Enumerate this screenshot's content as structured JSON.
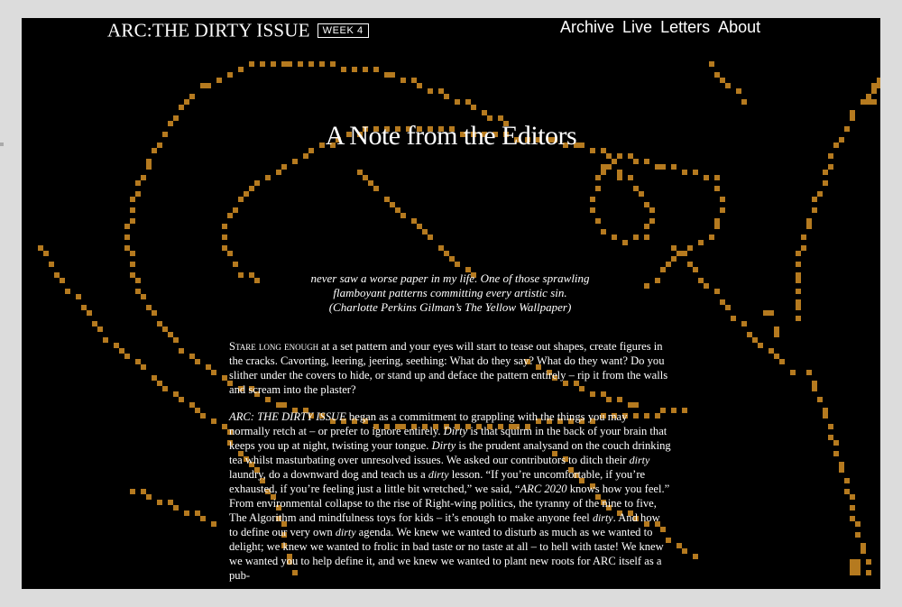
{
  "site": {
    "brand": "ARC:THE DIRTY ISSUE",
    "week": "WEEK 4"
  },
  "nav": [
    "Archive",
    "Live",
    "Letters",
    "About"
  ],
  "article": {
    "title": "A Note from the Editors",
    "epigraph": {
      "line1": "never saw a worse paper in my life. One of those sprawling",
      "line2": "flamboyant patterns committing every artistic sin.",
      "line3": "(Charlotte Perkins Gilman’s The Yellow Wallpaper)"
    },
    "p1": {
      "lead": "Stare long enough",
      "text": " at a set pattern and your eyes will start to tease out shapes, create figures in the cracks. Cavorting, leering, jeering, seething: What do they say? What do they want? Do you slither under the covers to hide, or stand up and deface the pattern entirely – rip it from the walls and scream into the plaster?"
    },
    "p2": {
      "s1": "ARC: THE DIRTY ISSUE",
      "s2": " began as a commitment to grappling with the things you may normally retch at – or prefer to ignore entirely. ",
      "s3": "Dirty",
      "s4": " is that squirm in the back of your brain that keeps you up at night, twisting your tongue. ",
      "s5": "Dirty",
      "s6": " is the prudent analysand on the couch drinking tea whilst masturbating over unresolved issues. We asked our contributors to ditch their ",
      "s7": "dirty",
      "s8": " laundry, do a downward dog and teach us a ",
      "s9": "dirty",
      "s10": " lesson. “If you’re uncomfortable, if you’re exhausted, if you’re feeling just a little bit wretched,” we said, “",
      "s11": "ARC 2020",
      "s12": " knows how you feel.” From environmental collapse to the rise of Right-wing politics, the tyranny of the nine to five, The Algorithm and mindfulness toys for kids – it’s enough to make anyone feel ",
      "s13": "dirty",
      "s14": ". And how to define our very own ",
      "s15": "dirty",
      "s16": " agenda. We knew we wanted to disturb as much as we wanted to delight; we knew we wanted to frolic in bad taste or no taste at all – to hell with taste! We knew we wanted you to help define it, and we knew we wanted to plant new roots for ARC itself as a pub-"
    }
  },
  "colors": {
    "background": "#000000",
    "pattern": "#b57a1f",
    "text": "#ffffff",
    "page": "#dcdcdc"
  }
}
